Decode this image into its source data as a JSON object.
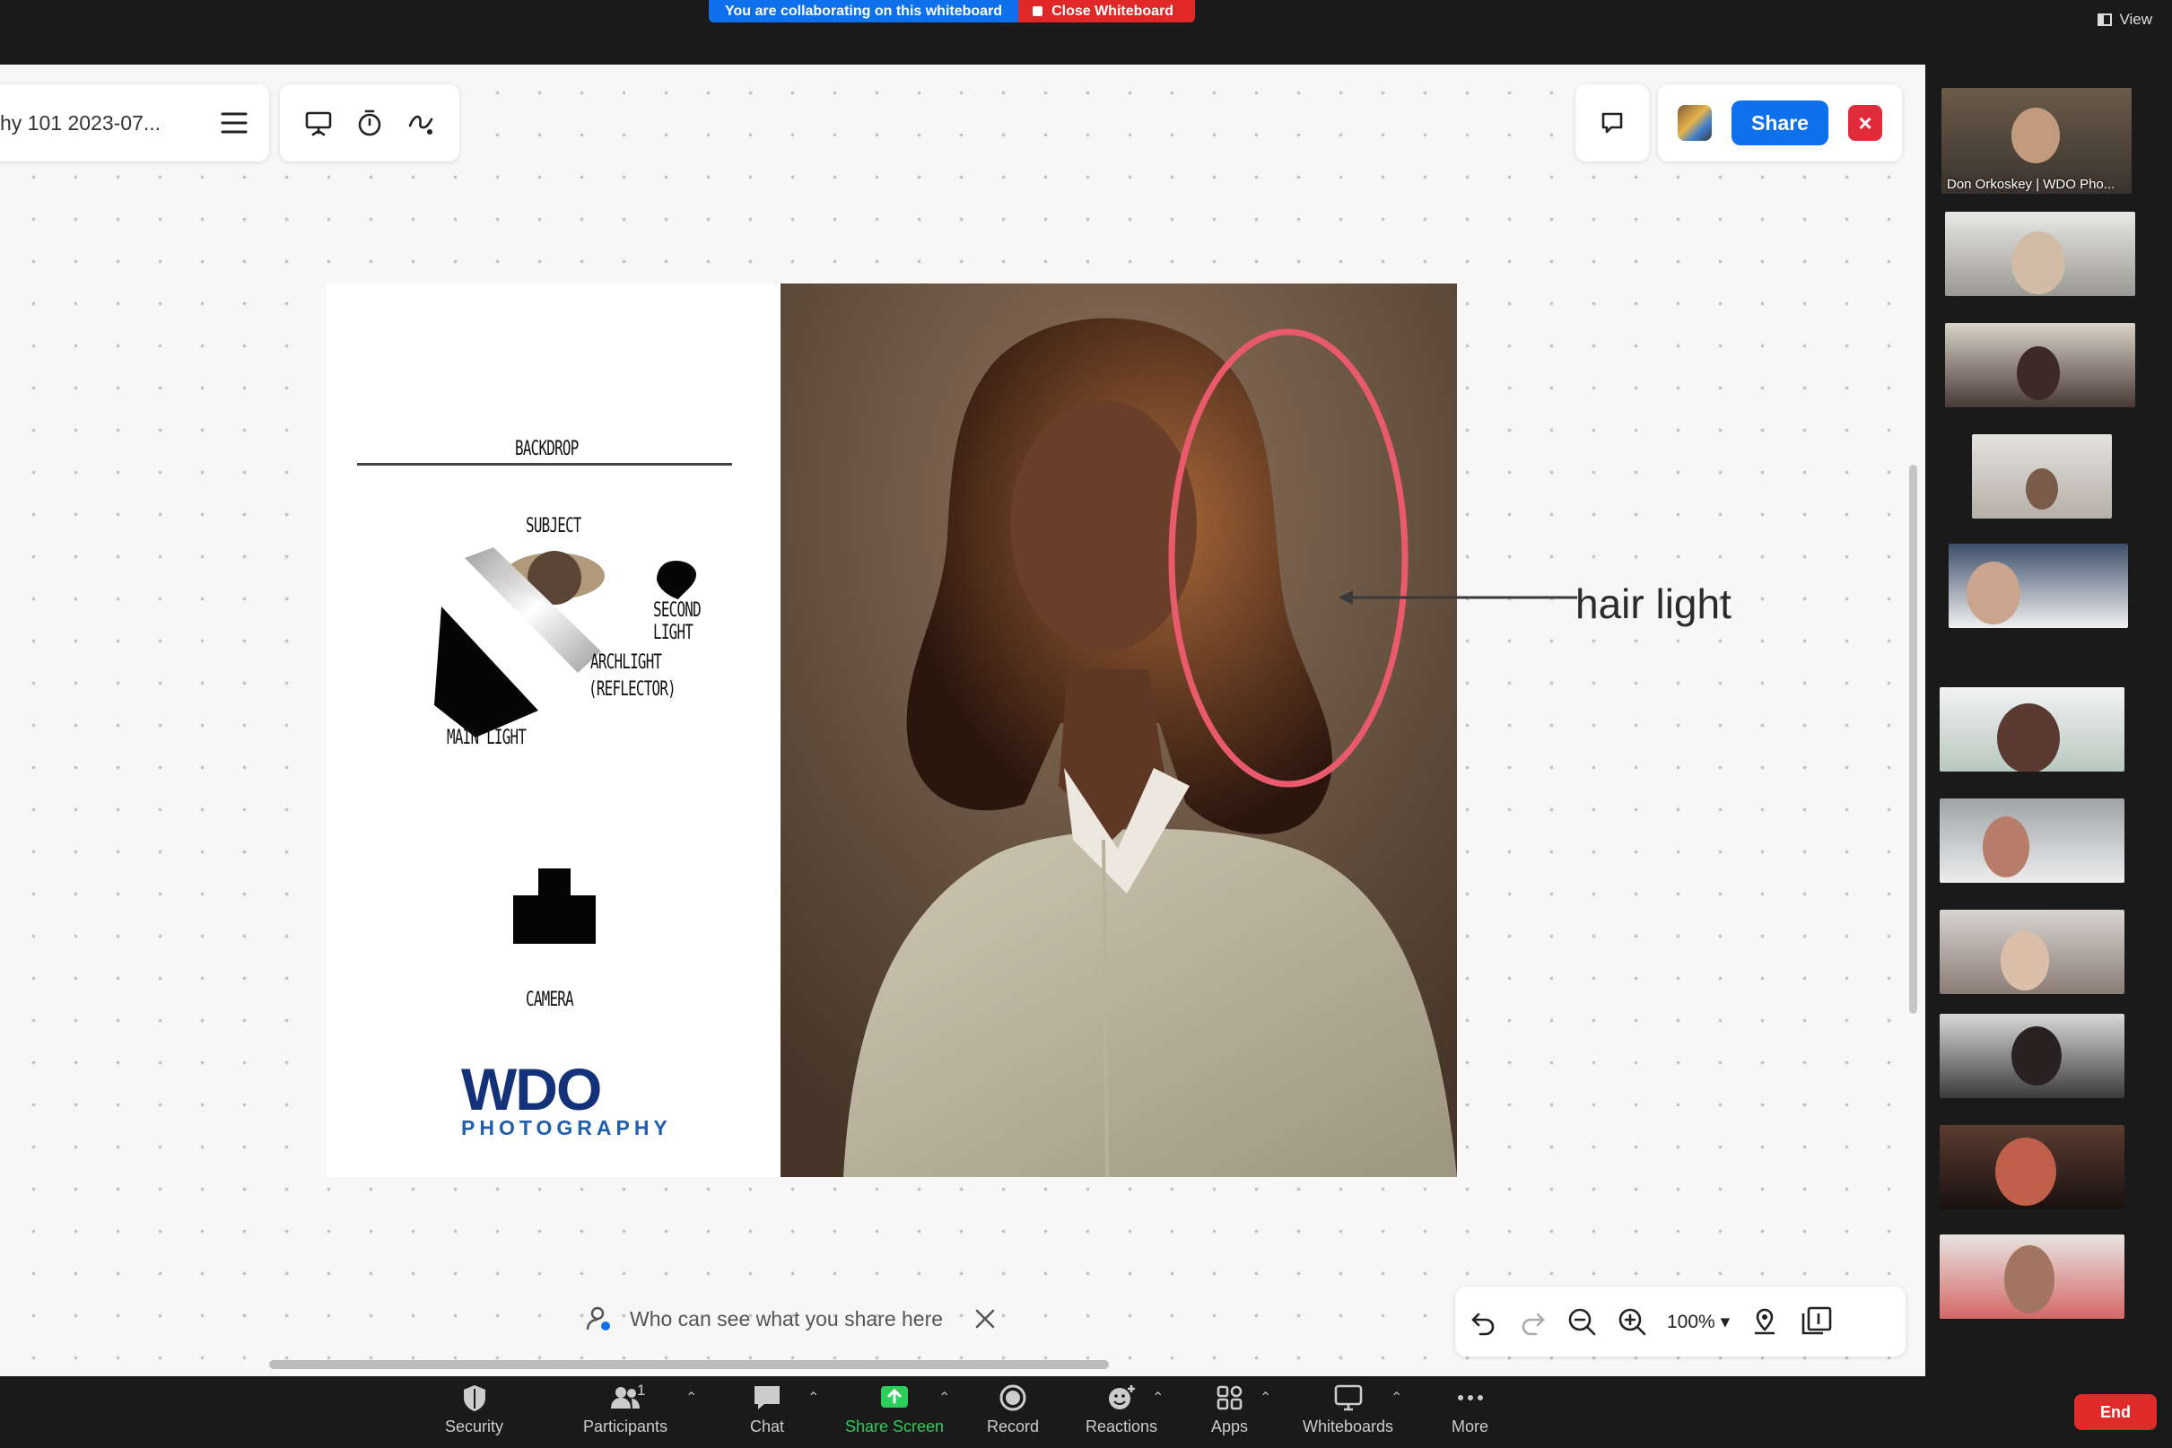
{
  "banner": {
    "collab_text": "You are collaborating on this whiteboard",
    "close_label": "Close Whiteboard"
  },
  "view_label": "View",
  "whiteboard": {
    "title": "hy 101 2023-07...",
    "share_label": "Share",
    "hair_light_label": "hair light",
    "who_can_see": "Who can see what you share here",
    "zoom_level": "100%"
  },
  "diagram": {
    "backdrop": "BACKDROP",
    "subject": "SUBJECT",
    "second_light": "SECOND LIGHT",
    "archlight_line1": "ARCHLIGHT",
    "archlight_line2": "(REFLECTOR)",
    "main_light": "MAIN LIGHT",
    "camera": "CAMERA",
    "logo_main": "WDO",
    "logo_sub": "PHOTOGRAPHY"
  },
  "participants": {
    "host_name": "Don Orkoskey | WDO Pho...",
    "count": "1"
  },
  "controls": {
    "security": "Security",
    "participants": "Participants",
    "chat": "Chat",
    "share_screen": "Share Screen",
    "record": "Record",
    "reactions": "Reactions",
    "apps": "Apps",
    "whiteboards": "Whiteboards",
    "more": "More",
    "end": "End"
  },
  "colors": {
    "accent": "#0e71eb",
    "danger": "#e02828",
    "share_green": "#2bcf5a",
    "annotation_pink": "#ea5a6d"
  }
}
